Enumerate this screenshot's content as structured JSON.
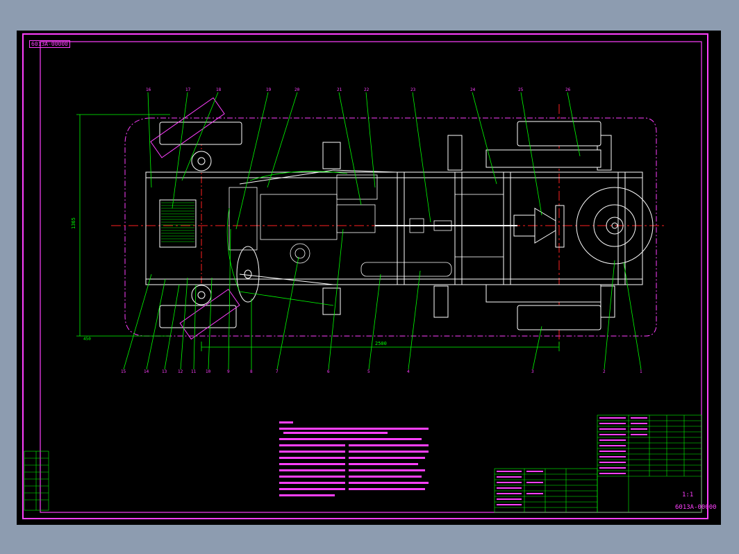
{
  "drawing": {
    "number_top": "6013A-00000",
    "number_bottom": "6013A-00000",
    "scale": "1:1",
    "dim_length": "2500",
    "dim_width": "1365",
    "dim_offset": "450"
  },
  "callouts_top": [
    "16",
    "17",
    "18",
    "19",
    "20",
    "21",
    "22",
    "23",
    "24",
    "25",
    "26"
  ],
  "callouts_bottom": [
    "15",
    "14",
    "13",
    "12",
    "11",
    "10",
    "9",
    "8",
    "7",
    "6",
    "5",
    "4",
    "3",
    "2",
    "1"
  ],
  "colors": {
    "background": "#8d9cb0",
    "paper": "#000000",
    "border": "#ff40ff",
    "geometry": "#ffffff",
    "leader": "#00ff00",
    "centerline": "#ff2020"
  }
}
